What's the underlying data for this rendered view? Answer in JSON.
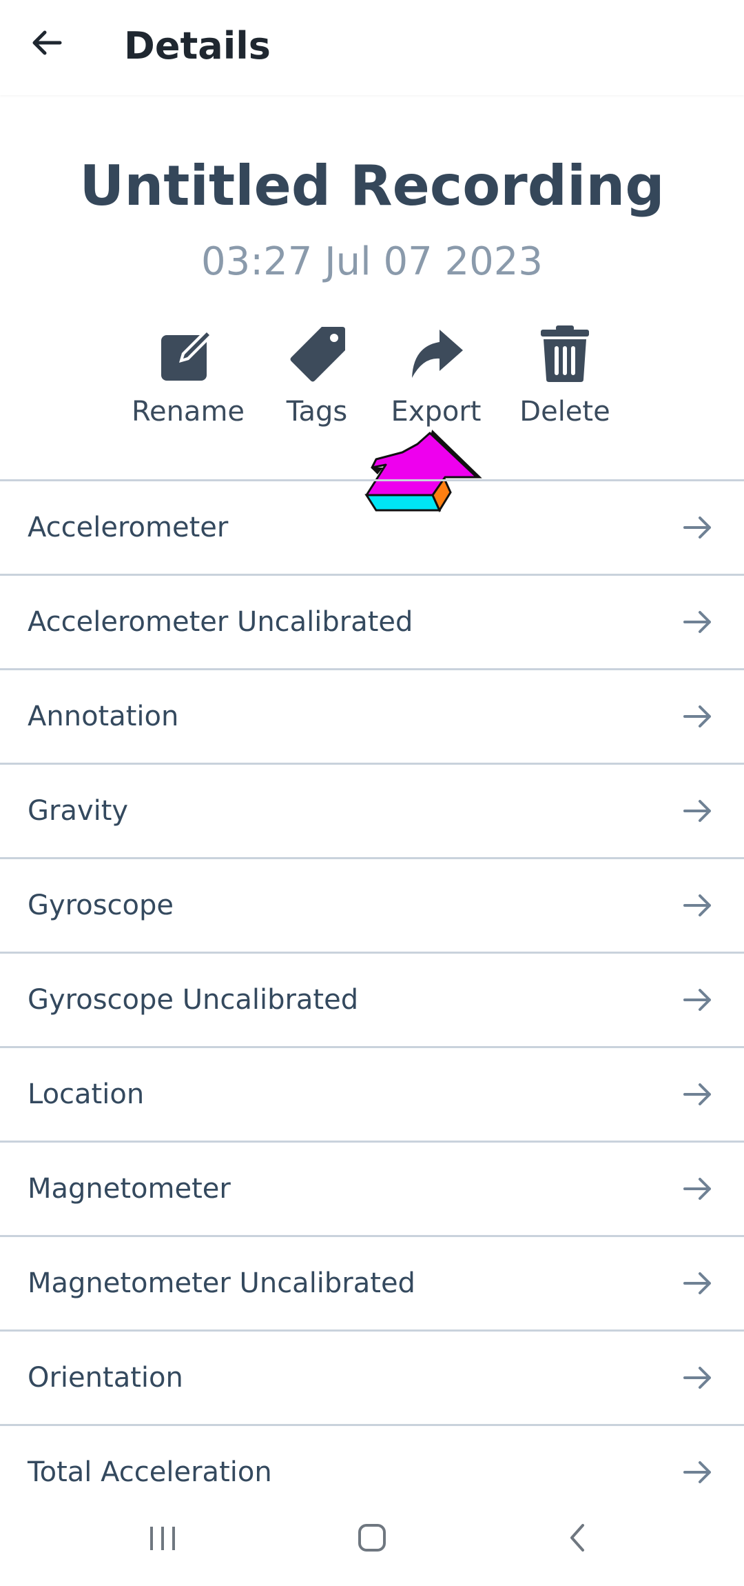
{
  "app_bar": {
    "title": "Details",
    "back_icon": "arrow-left-icon"
  },
  "recording": {
    "title": "Untitled Recording",
    "date": "03:27 Jul 07 2023"
  },
  "actions": [
    {
      "label": "Rename",
      "icon": "edit-icon"
    },
    {
      "label": "Tags",
      "icon": "tag-icon"
    },
    {
      "label": "Export",
      "icon": "share-icon"
    },
    {
      "label": "Delete",
      "icon": "trash-icon"
    }
  ],
  "sensors": [
    {
      "label": "Accelerometer"
    },
    {
      "label": "Accelerometer Uncalibrated"
    },
    {
      "label": "Annotation"
    },
    {
      "label": "Gravity"
    },
    {
      "label": "Gyroscope"
    },
    {
      "label": "Gyroscope Uncalibrated"
    },
    {
      "label": "Location"
    },
    {
      "label": "Magnetometer"
    },
    {
      "label": "Magnetometer Uncalibrated"
    },
    {
      "label": "Orientation"
    },
    {
      "label": "Total Acceleration"
    }
  ],
  "colors": {
    "primary_text": "#35475a",
    "muted_text": "#8a9aab",
    "divider": "#c9d2dc",
    "icon": "#3d4b5b",
    "cursor_fill": "#ee00ee",
    "cursor_side": "#ff7f11",
    "cursor_base": "#00e5f5"
  },
  "nav": {
    "recent_icon": "recent-apps-icon",
    "home_icon": "home-icon",
    "back_icon": "nav-back-icon"
  }
}
